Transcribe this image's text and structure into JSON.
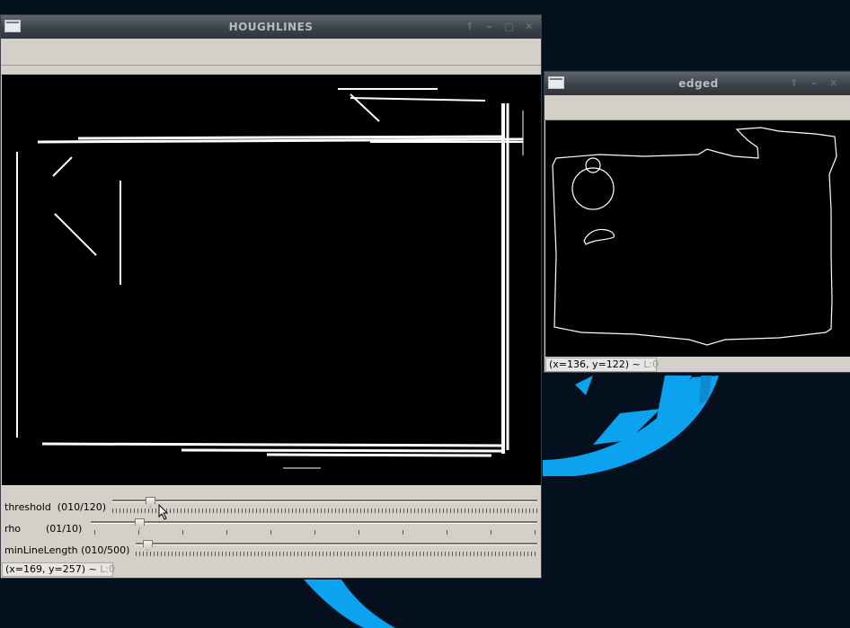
{
  "desktop": {
    "background": "#04101e",
    "accent": "#0ba2f0"
  },
  "houghlines": {
    "title": "HOUGHLINES",
    "titlebar_buttons": [
      "pin-icon",
      "minimize-icon",
      "maximize-icon",
      "close-icon"
    ],
    "trackbars": [
      {
        "label": "threshold  (010/120)",
        "value": 10,
        "max": 120
      },
      {
        "label": "rho        (01/10)",
        "value": 1,
        "max": 10
      },
      {
        "label": "minLineLength (010/500)",
        "value": 10,
        "max": 500
      }
    ],
    "status": "(x=169, y=257) ~ ",
    "status_mode": "L:0"
  },
  "edged": {
    "title": "edged",
    "titlebar_buttons": [
      "pin-icon",
      "minimize-icon",
      "close-icon"
    ],
    "status": "(x=136, y=122) ~ ",
    "status_mode": "L:0"
  }
}
